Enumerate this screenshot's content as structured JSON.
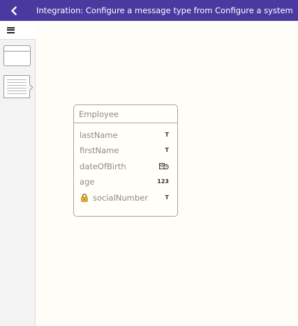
{
  "topbar": {
    "title": "Integration: Configure a message type from Configure a system",
    "bg_color": "#4a3aa0"
  },
  "sidebar": {
    "menu_icon": "hamburger-icon",
    "tools": [
      "entity-tool",
      "note-tool"
    ]
  },
  "entity": {
    "name": "Employee",
    "fields": [
      {
        "name": "lastName",
        "type": "T",
        "type_icon": "text-type-icon"
      },
      {
        "name": "firstName",
        "type": "T",
        "type_icon": "text-type-icon"
      },
      {
        "name": "dateOfBirth",
        "type_icon": "date-time-type-icon"
      },
      {
        "name": "age",
        "type": "123",
        "type_icon": "number-type-icon"
      },
      {
        "name": "socialNumber",
        "type": "T",
        "type_icon": "text-type-icon",
        "locked": true
      }
    ]
  }
}
